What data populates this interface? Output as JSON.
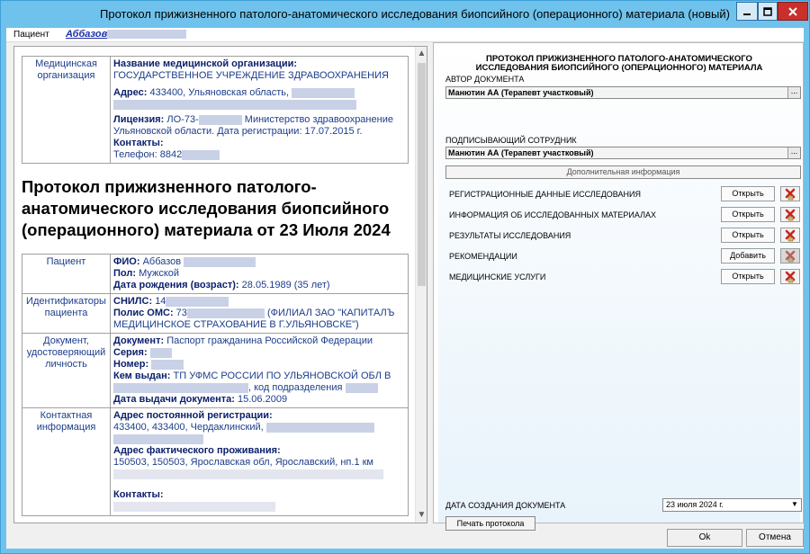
{
  "window": {
    "title": "Протокол прижизненного патолого-анатомического исследования биопсийного (операционного) материала (новый)"
  },
  "patient_bar": {
    "label": "Пациент",
    "name": "Аббазов"
  },
  "document": {
    "org_block": {
      "key": "Медицинская организация",
      "name_label": "Название медицинской организации:",
      "name_value": "ГОСУДАРСТВЕННОЕ УЧРЕЖДЕНИЕ ЗДРАВООХРАНЕНИЯ",
      "address_label": "Адрес:",
      "address_value": "433400, Ульяновская область,",
      "license_label": "Лицензия:",
      "license_prefix": "ЛО-73-",
      "license_rest": "Министерство здравоохранение Ульяновской области. Дата регистрации: 17.07.2015 г.",
      "contacts_label": "Контакты:",
      "phone_prefix": "Телефон: 8842"
    },
    "title": "Протокол прижизненного патолого-анатомического исследования биопсийного (операционного) материала от 23 Июля 2024",
    "patient_block": {
      "key": "Пациент",
      "fio_label": "ФИО:",
      "fio_value": "Аббазов",
      "sex_label": "Пол:",
      "sex_value": "Мужской",
      "dob_label": "Дата рождения (возраст):",
      "dob_value": "28.05.1989 (35 лет)"
    },
    "ids_block": {
      "key": "Идентификаторы пациента",
      "snils_label": "СНИЛС:",
      "snils_prefix": "14",
      "oms_label": "Полис ОМС:",
      "oms_prefix": "73",
      "oms_rest": "(ФИЛИАЛ ЗАО \"КАПИТАЛЪ МЕДИЦИНСКОЕ СТРАХОВАНИЕ В Г.УЛЬЯНОВСКЕ\")"
    },
    "id_doc_block": {
      "key": "Документ, удостоверяющий личность",
      "doc_label": "Документ:",
      "doc_value": "Паспорт гражданина Российской Федерации",
      "series_label": "Серия:",
      "number_label": "Номер:",
      "issued_label": "Кем выдан:",
      "issued_value": "ТП УФМС РОССИИ ПО УЛЬЯНОВСКОЙ ОБЛ В",
      "division_text": ", код подразделения",
      "issue_date_label": "Дата выдачи документа:",
      "issue_date_value": "15.06.2009"
    },
    "contact_block": {
      "key": "Контактная информация",
      "reg_label": "Адрес постоянной регистрации:",
      "reg_value": "433400, 433400, Чердаклинский,",
      "fact_label": "Адрес фактического проживания:",
      "fact_value": "150503, 150503, Ярославская обл, Ярославский, нп.1 км",
      "contacts_label": "Контакты:"
    }
  },
  "panel": {
    "title_line1": "ПРОТОКОЛ ПРИЖИЗНЕННОГО ПАТОЛОГО-АНАТОМИЧЕСКОГО",
    "title_line2": "ИССЛЕДОВАНИЯ БИОПСИЙНОГО (ОПЕРАЦИОННОГО) МАТЕРИАЛА",
    "author_label": "АВТОР ДОКУМЕНТА",
    "author_value": "Манютин АА (Терапевт участковый)",
    "signer_label": "ПОДПИСЫВАЮЩИЙ СОТРУДНИК",
    "signer_value": "Манютин АА (Терапевт участковый)",
    "combo_button": "...",
    "extra_info_button": "Дополнительная информация",
    "sections": [
      {
        "name": "РЕГИСТРАЦИОННЫЕ ДАННЫЕ ИССЛЕДОВАНИЯ",
        "action": "Открыть"
      },
      {
        "name": "ИНФОРМАЦИЯ ОБ ИССЛЕДОВАННЫХ МАТЕРИАЛАХ",
        "action": "Открыть"
      },
      {
        "name": "РЕЗУЛЬТАТЫ ИССЛЕДОВАНИЯ",
        "action": "Открыть"
      },
      {
        "name": "РЕКОМЕНДАЦИИ",
        "action": "Добавить"
      },
      {
        "name": "МЕДИЦИНСКИЕ УСЛУГИ",
        "action": "Открыть"
      }
    ],
    "date_label": "ДАТА СОЗДАНИЯ ДОКУМЕНТА",
    "date_value": "23   июля    2024 г.",
    "print_button": "Печать протокола"
  },
  "footer": {
    "ok": "Ok",
    "cancel": "Отмена"
  }
}
